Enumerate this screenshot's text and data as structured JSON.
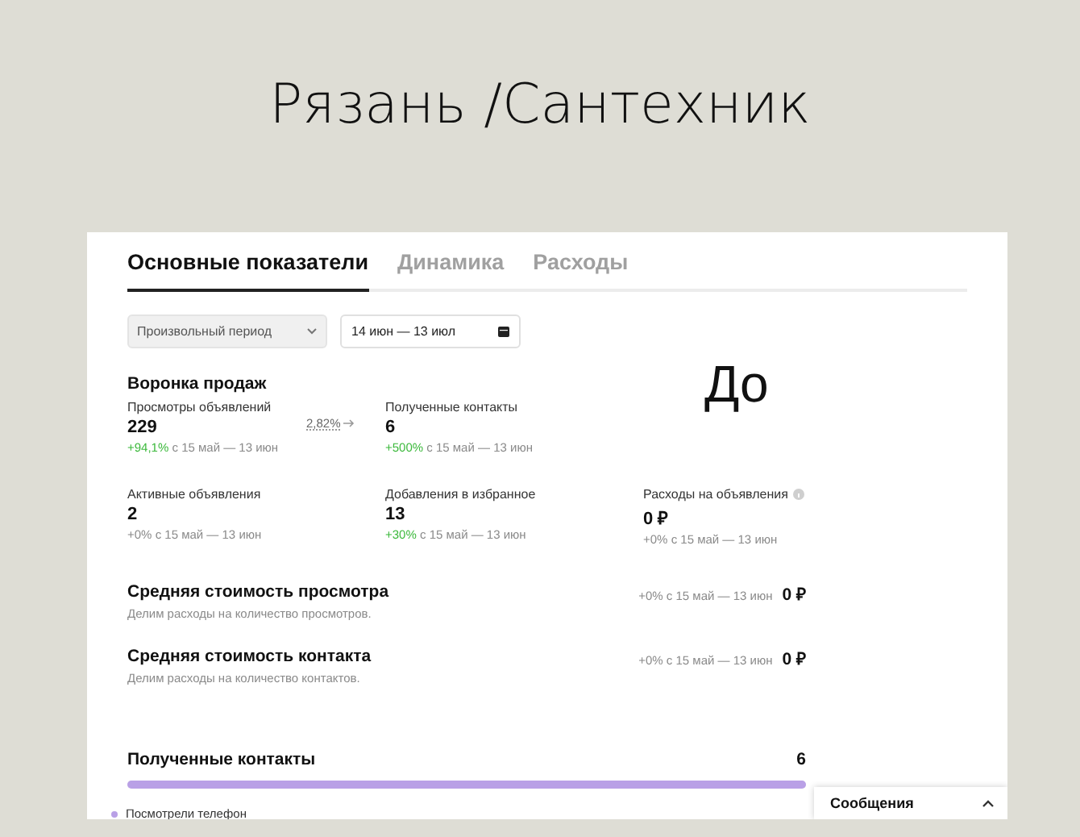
{
  "slide": {
    "title": "Рязань /Сантехник",
    "note": "До"
  },
  "tabs": [
    {
      "label": "Основные показатели",
      "selected": true
    },
    {
      "label": "Динамика",
      "selected": false
    },
    {
      "label": "Расходы",
      "selected": false
    }
  ],
  "filters": {
    "period": "Произвольный период",
    "date_range": "14 июн — 13 июл"
  },
  "funnel": {
    "title": "Воронка продаж",
    "conversion": "2,82%",
    "rows": [
      [
        {
          "label": "Просмотры объявлений",
          "value": "229",
          "change": "+94,1%",
          "color": "#3cb93c",
          "period": "с 15 май — 13 июн"
        },
        {
          "label": "Полученные контакты",
          "value": "6",
          "change": "+500%",
          "color": "#3cb93c",
          "period": "с 15 май — 13 июн"
        }
      ],
      [
        {
          "label": "Активные объявления",
          "value": "2",
          "change": "+0%",
          "color": "#8a8a8a",
          "period": "с 15 май — 13 июн"
        },
        {
          "label": "Добавления в избранное",
          "value": "13",
          "change": "+30%",
          "color": "#3cb93c",
          "period": "с 15 май — 13 июн"
        },
        {
          "label": "Расходы на объявления",
          "value": "0 ₽",
          "change": "+0%",
          "color": "#8a8a8a",
          "period": "с 15 май — 13 июн",
          "info": true
        }
      ]
    ]
  },
  "metrics": [
    {
      "title": "Средняя стоимость просмотра",
      "description": "Делим расходы на количество просмотров.",
      "change": "+0%",
      "period": "с 15 май — 13 июн",
      "value": "0 ₽"
    },
    {
      "title": "Средняя стоимость контакта",
      "description": "Делим расходы на количество контактов.",
      "change": "+0%",
      "period": "с 15 май — 13 июн",
      "value": "0 ₽"
    }
  ],
  "contacts": {
    "title": "Полученные контакты",
    "value": "6",
    "level": 1,
    "legend": [
      {
        "label": "Посмотрели телефон",
        "color": "#b9a0e6"
      }
    ]
  },
  "messages": {
    "label": "Сообщения"
  }
}
